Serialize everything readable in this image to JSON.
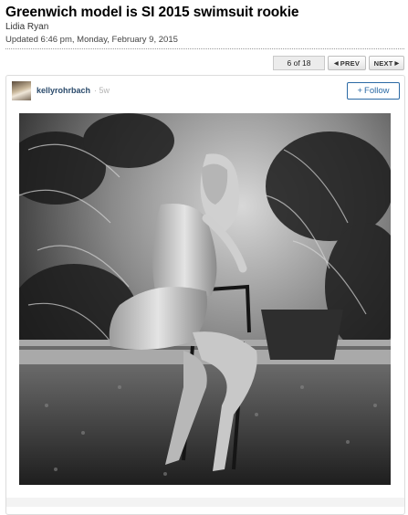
{
  "article": {
    "headline": "Greenwich model is SI 2015 swimsuit rookie",
    "author": "Lidia Ryan",
    "updated": "Updated 6:46 pm, Monday, February 9, 2015"
  },
  "gallery": {
    "position": "6 of 18",
    "prev_label": "PREV",
    "next_label": "NEXT"
  },
  "post": {
    "username": "kellyrohrbach",
    "age": "· 5w",
    "follow_label": "Follow",
    "follow_icon": "+"
  },
  "icons": {
    "prev": "arrow-left-icon",
    "next": "arrow-right-icon"
  }
}
